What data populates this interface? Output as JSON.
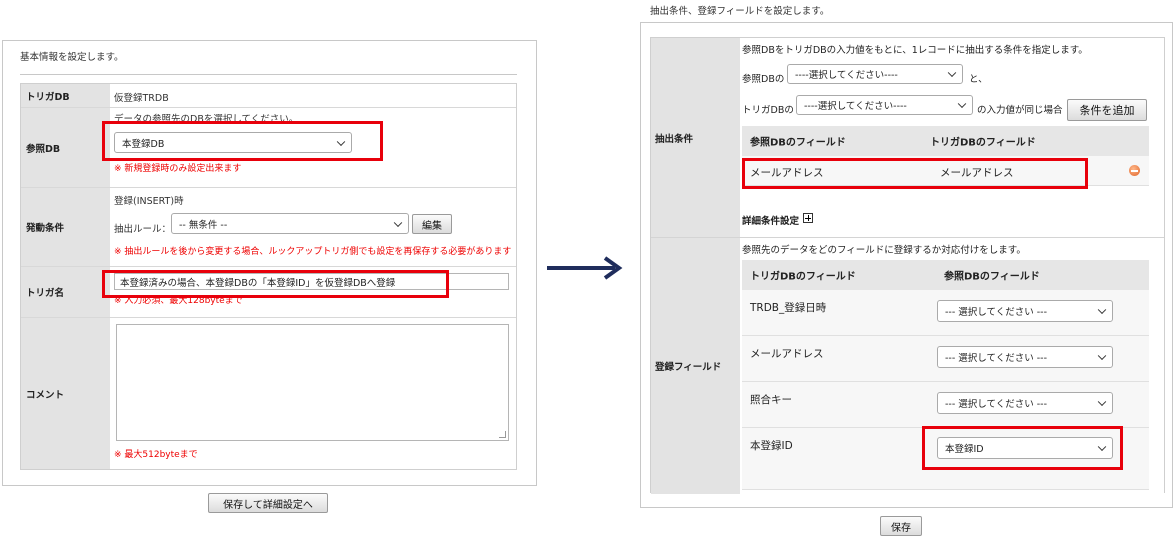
{
  "left": {
    "intro": "基本情報を設定します。",
    "rows": {
      "trigger_db": {
        "label": "トリガDB",
        "value": "仮登録TRDB"
      },
      "ref_db": {
        "label": "参照DB",
        "help": "データの参照先のDBを選択してください。",
        "select_value": "本登録DB",
        "note": "※ 新規登録時のみ設定出来ます"
      },
      "condition": {
        "label": "発動条件",
        "event": "登録(INSERT)時",
        "rule_label": "抽出ルール：",
        "rule_value": "-- 無条件 --",
        "edit_button": "編集",
        "note": "※ 抽出ルールを後から変更する場合、ルックアップトリガ側でも設定を再保存する必要があります"
      },
      "trigger_name": {
        "label": "トリガ名",
        "value": "本登録済みの場合、本登録DBの「本登録ID」を仮登録DBへ登録",
        "note": "※ 入力必須、最大128byteまで"
      },
      "comment": {
        "label": "コメント",
        "value": "",
        "note": "※ 最大512byteまで"
      }
    },
    "save_button": "保存して詳細設定へ"
  },
  "right": {
    "intro": "抽出条件、登録フィールドを設定します。",
    "extract": {
      "label": "抽出条件",
      "help": "参照DBをトリガDBの入力値をもとに、1レコードに抽出する条件を指定します。",
      "ref_prefix": "参照DBの",
      "ref_select": "----選択してください----",
      "ref_suffix": "と、",
      "trig_prefix": "トリガDBの",
      "trig_select": "----選択してください----",
      "trig_suffix": "の入力値が同じ場合",
      "add_button": "条件を追加",
      "col_ref": "参照DBのフィールド",
      "col_trig": "トリガDBのフィールド",
      "pair": {
        "ref": "メールアドレス",
        "trig": "メールアドレス"
      },
      "detail_label": "詳細条件設定"
    },
    "register": {
      "label": "登録フィールド",
      "help": "参照先のデータをどのフィールドに登録するか対応付けをします。",
      "col_trig": "トリガDBのフィールド",
      "col_ref": "参照DBのフィールド",
      "rows": [
        {
          "field": "TRDB_登録日時",
          "select": "--- 選択してください ---"
        },
        {
          "field": "メールアドレス",
          "select": "--- 選択してください ---"
        },
        {
          "field": "照合キー",
          "select": "--- 選択してください ---"
        },
        {
          "field": "本登録ID",
          "select": "本登録ID"
        }
      ]
    },
    "save_button": "保存"
  },
  "colors": {
    "highlight": "#e8000b",
    "arrow": "#1f2d5c",
    "note_red": "#ee0000"
  },
  "icons": [
    "chevron-down-icon",
    "minus-circle-icon",
    "plus-box-icon",
    "right-arrow-icon"
  ]
}
